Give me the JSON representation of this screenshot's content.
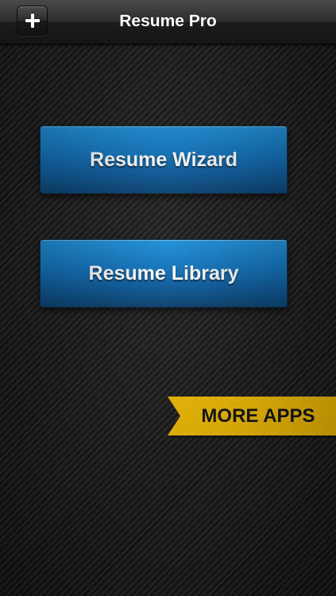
{
  "navbar": {
    "title": "Resume Pro",
    "add_icon": "plus-icon"
  },
  "main": {
    "wizard_label": "Resume Wizard",
    "library_label": "Resume Library"
  },
  "promo": {
    "more_apps_label": "MORE APPS",
    "color": "#fcc400"
  },
  "colors": {
    "button_blue": "#0f73bd",
    "background": "#1b1b1b"
  }
}
